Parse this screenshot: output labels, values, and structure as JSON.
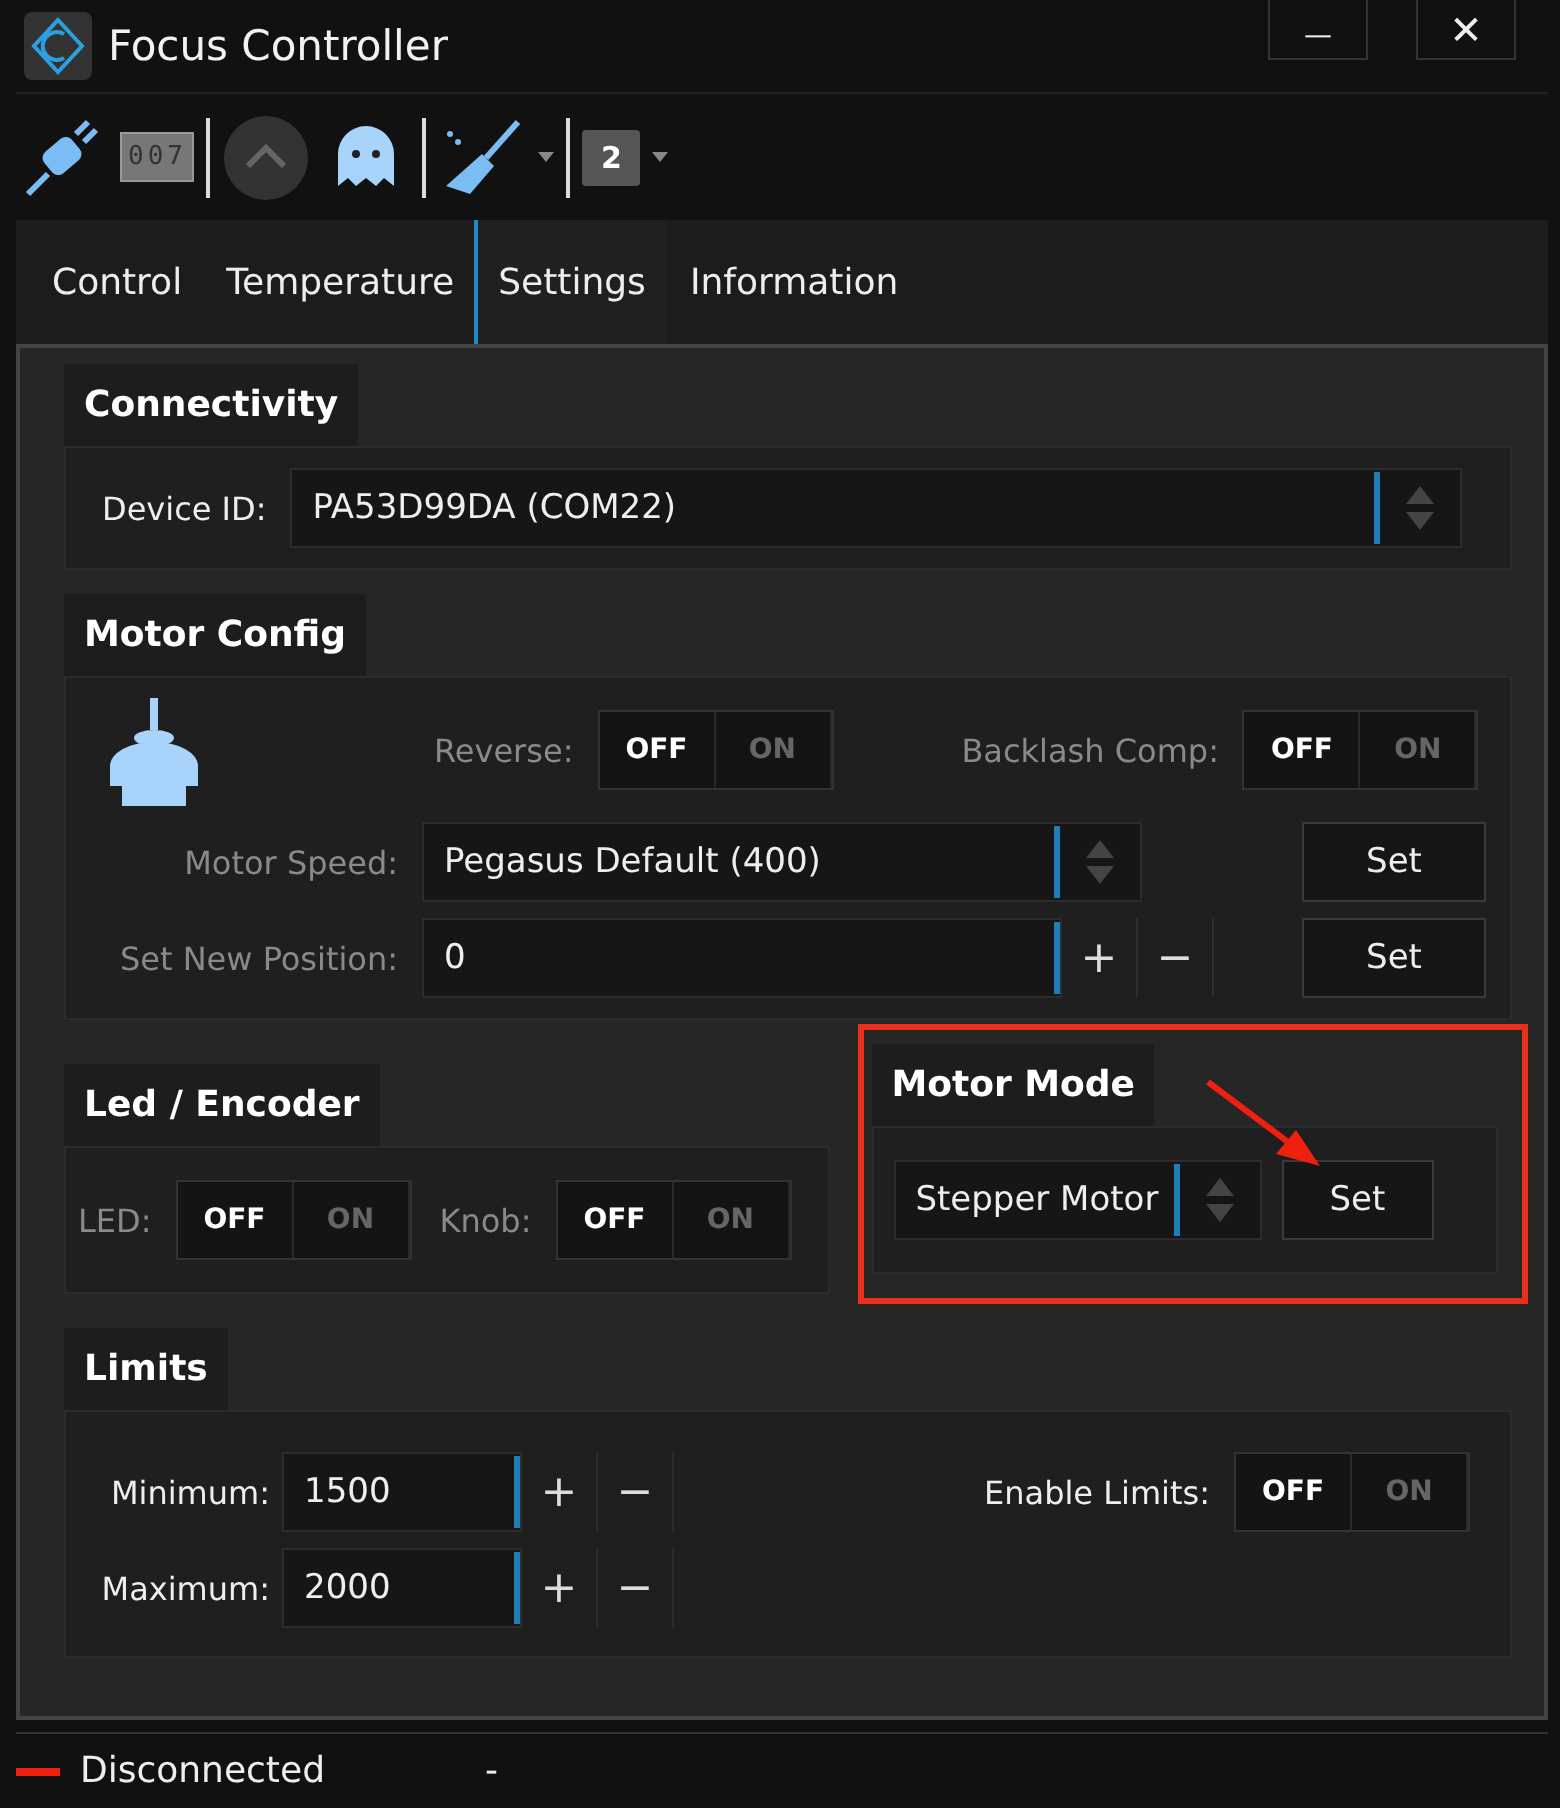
{
  "window": {
    "title": "Focus Controller",
    "buttons": [
      {
        "kind": "minimize",
        "text": "—"
      },
      {
        "kind": "close",
        "text": "✕"
      }
    ]
  },
  "toolbar": {
    "counter": "007",
    "profile": "2"
  },
  "tabs": [
    {
      "label": "Control",
      "selected": false
    },
    {
      "label": "Temperature",
      "selected": false
    },
    {
      "label": "Settings",
      "selected": true
    },
    {
      "label": "Information",
      "selected": false
    }
  ],
  "connectivity": {
    "title": "Connectivity",
    "device_label": "Device ID:",
    "device_value": "PA53D99DA (COM22)"
  },
  "motor_config": {
    "title": "Motor Config",
    "toggles": [
      {
        "label": "Reverse:",
        "disabled": true,
        "options": [
          {
            "text": "OFF",
            "selected": true
          },
          {
            "text": "ON",
            "selected": false
          }
        ]
      },
      {
        "label": "Backlash Comp:",
        "disabled": true,
        "options": [
          {
            "text": "OFF",
            "selected": true
          },
          {
            "text": "ON",
            "selected": false
          }
        ]
      }
    ],
    "speed": {
      "label": "Motor Speed:",
      "disabled": true,
      "value": "Pegasus Default (400)",
      "button": "Set"
    },
    "position": {
      "label": "Set New Position:",
      "disabled": true,
      "value": "0",
      "plus": "+",
      "minus": "−",
      "button": "Set"
    }
  },
  "led_encoder": {
    "title": "Led / Encoder",
    "toggles": [
      {
        "label": "LED:",
        "disabled": true,
        "options": [
          {
            "text": "OFF",
            "selected": true
          },
          {
            "text": "ON",
            "selected": false
          }
        ]
      },
      {
        "label": "Knob:",
        "disabled": true,
        "options": [
          {
            "text": "OFF",
            "selected": true
          },
          {
            "text": "ON",
            "selected": false
          }
        ]
      }
    ]
  },
  "motor_mode": {
    "title": "Motor Mode",
    "value": "Stepper Motor",
    "button": "Set",
    "highlighted": true
  },
  "limits": {
    "title": "Limits",
    "fields": [
      {
        "label": "Minimum:",
        "value": "1500",
        "plus": "+",
        "minus": "−"
      },
      {
        "label": "Maximum:",
        "value": "2000",
        "plus": "+",
        "minus": "−"
      }
    ],
    "toggle": {
      "label": "Enable Limits:",
      "disabled": false,
      "options": [
        {
          "text": "OFF",
          "selected": true
        },
        {
          "text": "ON",
          "selected": false
        }
      ]
    }
  },
  "status_bar": {
    "status": "Disconnected",
    "connected": false,
    "detail": "-"
  }
}
